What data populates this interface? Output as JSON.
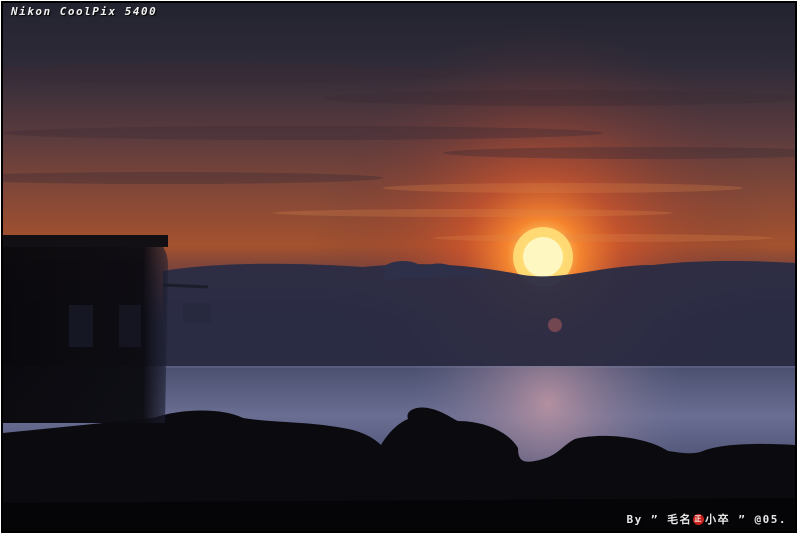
{
  "photo": {
    "camera_label": "Nikon CoolPix 5400",
    "signature": {
      "prefix": "By ” 毛名",
      "seal": "正",
      "suffix": "小卒 ”  @05."
    },
    "colors": {
      "sky_top": "#252636",
      "sun_core": "#fff3a8",
      "sun_glow": "#ff7a2a",
      "cloud_band": "#2b2e47",
      "sea": "#5c6185",
      "rocks": "#0b0b10"
    }
  }
}
